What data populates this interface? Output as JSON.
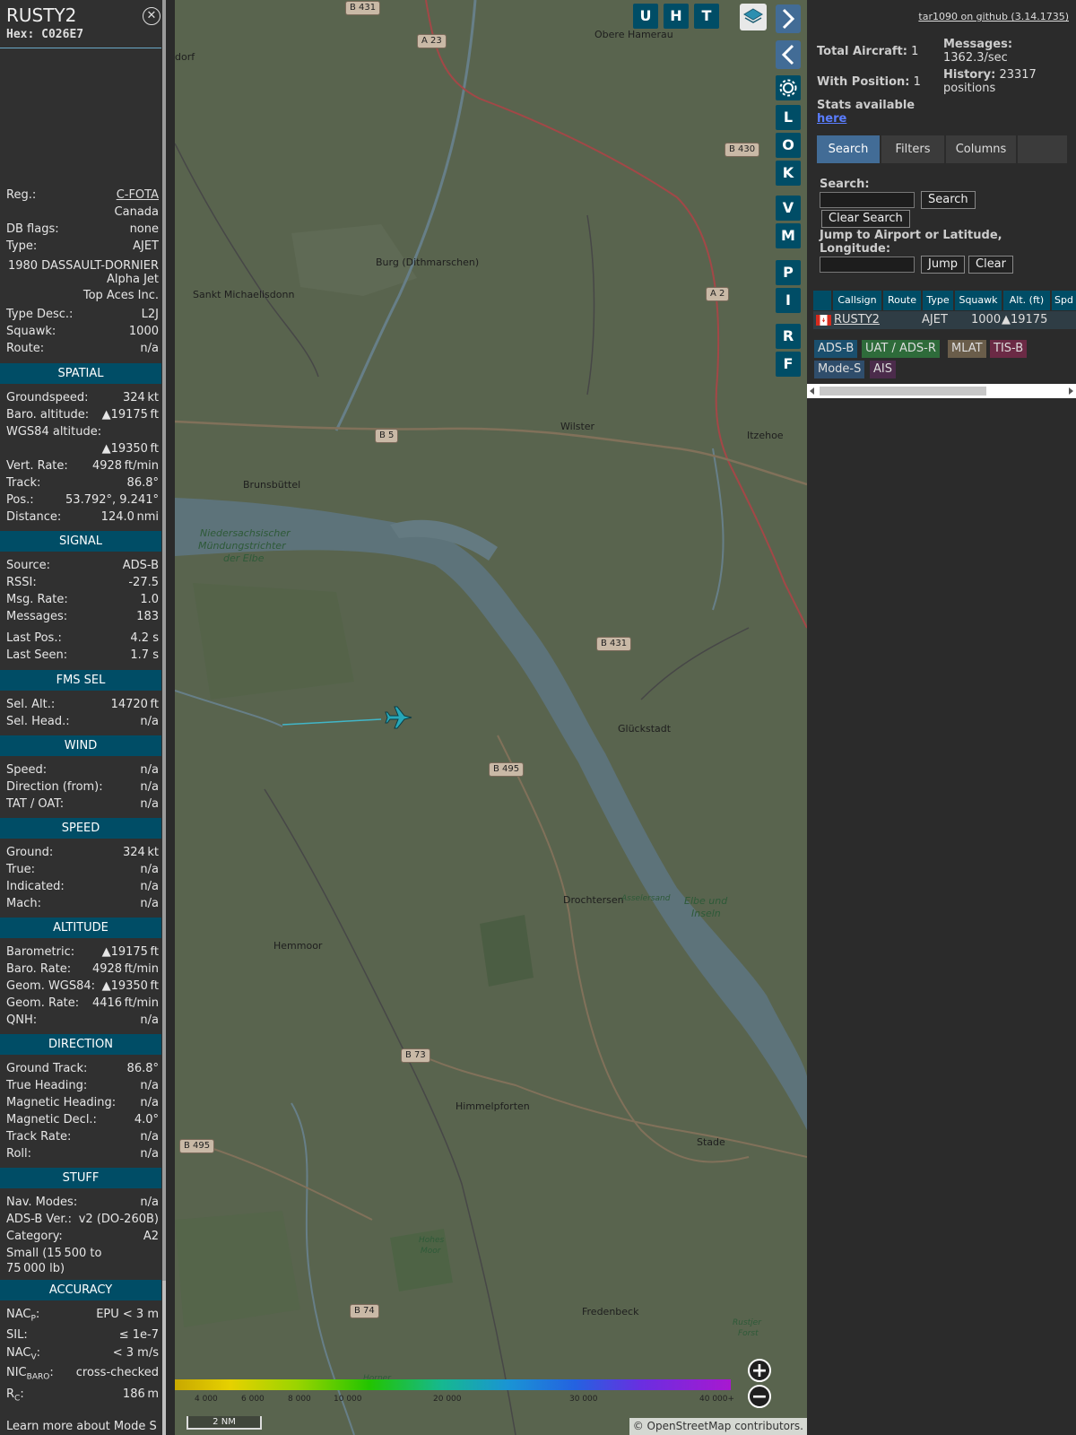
{
  "aircraft": {
    "callsign": "RUSTY2",
    "hex": "Hex: C026E7",
    "close_glyph": "✕",
    "reg_label": "Reg.:",
    "reg": "C-FOTA",
    "country": "Canada",
    "dbflags_label": "DB flags:",
    "dbflags": "none",
    "type_label": "Type:",
    "type": "AJET",
    "type_full_1": "1980 DASSAULT-DORNIER",
    "type_full_2": "Alpha Jet",
    "operator": "Top Aces Inc.",
    "typedesc_label": "Type Desc.:",
    "typedesc": "L2J",
    "squawk_label": "Squawk:",
    "squawk": "1000",
    "route_label": "Route:",
    "route": "n/a"
  },
  "spatial": {
    "title": "SPATIAL",
    "gs_label": "Groundspeed:",
    "gs": "324 kt",
    "baro_label": "Baro. altitude:",
    "baro": "▲19175 ft",
    "wgs_label": "WGS84 altitude:",
    "wgs": "▲19350 ft",
    "vr_label": "Vert. Rate:",
    "vr": "4928 ft/min",
    "track_label": "Track:",
    "track": "86.8°",
    "pos_label": "Pos.:",
    "pos": "53.792°, 9.241°",
    "dist_label": "Distance:",
    "dist": "124.0 nmi"
  },
  "signal": {
    "title": "SIGNAL",
    "source_label": "Source:",
    "source": "ADS-B",
    "rssi_label": "RSSI:",
    "rssi": "-27.5",
    "rate_label": "Msg. Rate:",
    "rate": "1.0",
    "msgs_label": "Messages:",
    "msgs": "183",
    "lastpos_label": "Last Pos.:",
    "lastpos": "4.2 s",
    "lastseen_label": "Last Seen:",
    "lastseen": "1.7 s"
  },
  "fms": {
    "title": "FMS SEL",
    "alt_label": "Sel. Alt.:",
    "alt": "14720 ft",
    "head_label": "Sel. Head.:",
    "head": "n/a"
  },
  "wind": {
    "title": "WIND",
    "speed_label": "Speed:",
    "speed": "n/a",
    "dir_label": "Direction (from):",
    "dir": "n/a",
    "tat_label": "TAT / OAT:",
    "tat": "n/a"
  },
  "speed": {
    "title": "SPEED",
    "ground_label": "Ground:",
    "ground": "324 kt",
    "true_label": "True:",
    "true": "n/a",
    "ind_label": "Indicated:",
    "ind": "n/a",
    "mach_label": "Mach:",
    "mach": "n/a"
  },
  "altitude": {
    "title": "ALTITUDE",
    "baro_label": "Barometric:",
    "baro": "▲19175 ft",
    "brate_label": "Baro. Rate:",
    "brate": "4928 ft/min",
    "geom_label": "Geom. WGS84:",
    "geom": "▲19350 ft",
    "grate_label": "Geom. Rate:",
    "grate": "4416 ft/min",
    "qnh_label": "QNH:",
    "qnh": "n/a"
  },
  "direction": {
    "title": "DIRECTION",
    "gt_label": "Ground Track:",
    "gt": "86.8°",
    "th_label": "True Heading:",
    "th": "n/a",
    "mh_label": "Magnetic Heading:",
    "mh": "n/a",
    "md_label": "Magnetic Decl.:",
    "md": "4.0°",
    "tr_label": "Track Rate:",
    "tr": "n/a",
    "roll_label": "Roll:",
    "roll": "n/a"
  },
  "stuff": {
    "title": "STUFF",
    "nav_label": "Nav. Modes:",
    "nav": "n/a",
    "adsb_label": "ADS-B Ver.:",
    "adsb": "v2 (DO-260B)",
    "cat_label": "Category:",
    "cat": "A2",
    "cat_desc_1": "Small (15 500 to",
    "cat_desc_2": "75 000 lb)"
  },
  "accuracy": {
    "title": "ACCURACY",
    "nacp_label": "NAC",
    "nacp_sub": "P",
    "nacp": "EPU < 3 m",
    "sil_label": "SIL:",
    "sil": "≤ 1e-7",
    "nacv_label": "NAC",
    "nacv_sub": "V",
    "nacv": "< 3 m/s",
    "nic_label": "NIC",
    "nic_sub": "BARO",
    "nic": "cross-checked",
    "rc_label": "R",
    "rc_sub": "C",
    "rc": "186 m",
    "learn": "Learn more about Mode S"
  },
  "map": {
    "buttons": [
      "U",
      "H",
      "T"
    ],
    "side_buttons": [
      "L",
      "O",
      "K",
      "V",
      "M",
      "P",
      "I",
      "R",
      "F"
    ],
    "places": [
      {
        "name": "Obere Hamerau"
      },
      {
        "name": "dorf"
      },
      {
        "name": "Burg (Dithmarschen)"
      },
      {
        "name": "Sankt Michaelisdonn"
      },
      {
        "name": "Wilster"
      },
      {
        "name": "Itzehoe"
      },
      {
        "name": "Brunsbüttel"
      },
      {
        "name": "Glückstadt"
      },
      {
        "name": "Drochtersen"
      },
      {
        "name": "Hemmoor"
      },
      {
        "name": "Himmelpforten"
      },
      {
        "name": "Stade"
      },
      {
        "name": "Fredenbeck"
      }
    ],
    "water_labels": [
      {
        "name": "Niedersachsischer"
      },
      {
        "name": "Mündungstrichter"
      },
      {
        "name": "der Elbe"
      },
      {
        "name": "Asselersand"
      },
      {
        "name": "Elbe und"
      },
      {
        "name": "Inseln"
      },
      {
        "name": "Hohes"
      },
      {
        "name": "Moor"
      },
      {
        "name": "Rustjer"
      },
      {
        "name": "Forst"
      },
      {
        "name": "Horner"
      }
    ],
    "road_badges": [
      "B 431",
      "A 23",
      "B 430",
      "B 5",
      "B 431",
      "B 495",
      "B 73",
      "B 495",
      "B 74",
      "A 2"
    ],
    "legend_ticks": [
      "4 000",
      "6 000",
      "8 000",
      "10 000",
      "20 000",
      "30 000",
      "40 000+"
    ],
    "scale": "2 NM",
    "attribution": "© OpenStreetMap contributors.",
    "zoom_in": "+",
    "zoom_out": "−"
  },
  "side": {
    "github": "tar1090 on github (3.14.1735)",
    "total_label": "Total Aircraft:",
    "total": "1",
    "withpos_label": "With Position:",
    "withpos": "1",
    "stats_label": "Stats available",
    "stats_link": "here",
    "msgs_label": "Messages:",
    "msgs": "1362.3/sec",
    "hist_label": "History:",
    "hist": "23317",
    "hist_unit": "positions",
    "tabs": [
      "Search",
      "Filters",
      "Columns"
    ],
    "search_label": "Search:",
    "search_button": "Search",
    "clear_search": "Clear Search",
    "jump_label_1": "Jump to Airport or Latitude,",
    "jump_label_2": "Longitude:",
    "jump_button": "Jump",
    "clear_button": "Clear",
    "table_headers": [
      "Callsign",
      "Route",
      "Type",
      "Squawk",
      "Alt. (ft)",
      "Spd"
    ],
    "table_rows": [
      {
        "callsign": "RUSTY2",
        "type": "AJET",
        "squawk": "1000",
        "alt": "▲19175"
      }
    ],
    "sources": [
      "ADS-B",
      "UAT / ADS-R",
      "MLAT",
      "TIS-B",
      "Mode-S",
      "AIS"
    ],
    "colors": {
      "adsb": "#1a4f6e",
      "uat": "#2e6b3a",
      "mlat": "#6a5d4a",
      "tisb": "#6b2a45",
      "modes": "#2f4d6b",
      "ais": "#4b2b4b"
    }
  },
  "colors": {
    "accent": "#004d66",
    "panel": "#303030",
    "map_tint": "#5e6b52",
    "tab_active": "#426c96"
  }
}
